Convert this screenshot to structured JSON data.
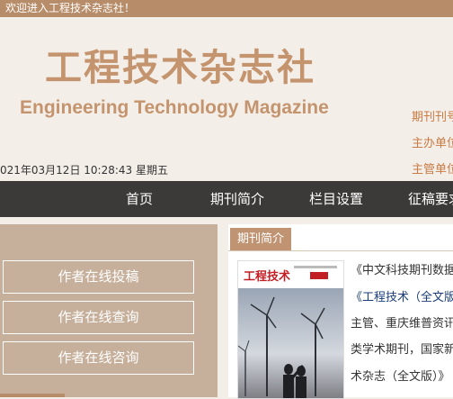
{
  "topbar": {
    "welcome": "欢迎进入工程技术杂志社！"
  },
  "header": {
    "logo_cn": "工程技术杂志社",
    "logo_en": "Engineering Technology Magazine",
    "info": [
      "期刊刊号",
      "主办单位",
      "主管单位"
    ],
    "datetime": "021年03月12日 10:28:43 星期五"
  },
  "nav": {
    "items": [
      "首页",
      "期刊简介",
      "栏目设置",
      "征稿要求"
    ]
  },
  "sidebar": {
    "buttons": [
      "作者在线投稿",
      "作者在线查询",
      "作者在线咨询"
    ]
  },
  "content": {
    "title": "期刊简介",
    "cover_title": "工程技术",
    "lines": [
      "《中文科技期刊数据",
      "《工程技术（全文版",
      "主管、重庆维普资讯",
      "类学术期刊，国家新",
      "术杂志（全文版）》"
    ]
  },
  "colors": {
    "accent": "#b78c69",
    "nav_bg": "#3c3a38",
    "logo": "#c4946e",
    "info_text": "#c87b45"
  }
}
